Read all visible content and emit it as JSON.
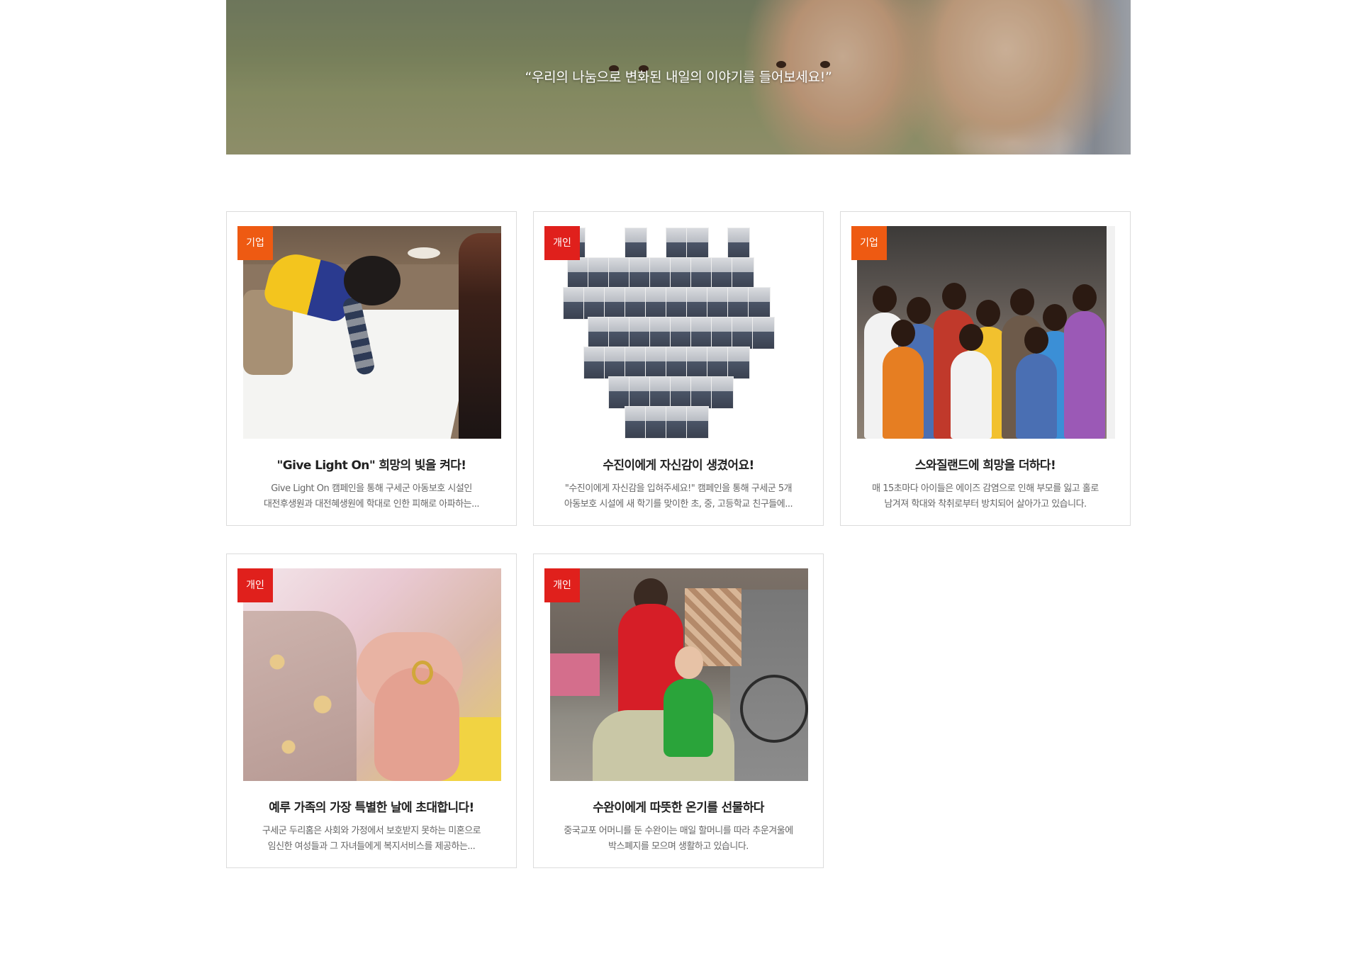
{
  "hero": {
    "quote": "“우리의 나눔으로 변화된 내일의 이야기를 들어보세요!”"
  },
  "colors": {
    "badge_corporate": "#ee5a12",
    "badge_individual": "#e0201c",
    "card_border": "#dcdcdc",
    "title_text": "#222222",
    "description_text": "#666666"
  },
  "cards": [
    {
      "badge": "기업",
      "badge_type": "corporate",
      "image": "child-drawing-on-paper-photo",
      "title": "\"Give Light On\" 희망의 빛을 켜다!",
      "desc_line1": "Give Light On 캠페인을 통해 구세군 아동보호 시설인",
      "desc_line2": "대전후생원과 대전혜생원에 학대로 인한 피해로 아파하는..."
    },
    {
      "badge": "개인",
      "badge_type": "individual",
      "image": "heart-photo-collage",
      "title": "수진이에게 자신감이 생겼어요!",
      "desc_line1": "\"수진이에게 자신감을 입혀주세요!\" 캠페인을 통해 구세군 5개",
      "desc_line2": "아동보호 시설에 새 학기를 맞이한 초, 중, 고등학교 친구들에..."
    },
    {
      "badge": "기업",
      "badge_type": "corporate",
      "image": "waving-children-photo",
      "title": "스와질랜드에 희망을 더하다!",
      "desc_line1": "매 15초마다 아이들은 에이즈 감염으로 인해 부모를 잃고 홀로",
      "desc_line2": "남겨져 학대와 착취로부터 방치되어 살아가고 있습니다."
    },
    {
      "badge": "개인",
      "badge_type": "individual",
      "image": "baby-hand-ring-photo",
      "title": "예루 가족의 가장 특별한 날에 초대합니다!",
      "desc_line1": "구세군 두리홈은 사회와 가정에서 보호받지 못하는 미혼으로",
      "desc_line2": "임신한 여성들과 그 자녀들에게 복지서비스를 제공하는..."
    },
    {
      "badge": "개인",
      "badge_type": "individual",
      "image": "grandmother-and-child-photo",
      "title": "수완이에게 따뜻한 온기를 선물하다",
      "desc_line1": "중국교포 어머니를 둔 수완이는 매일 할머니를 따라 추운겨울에",
      "desc_line2": "박스폐지를 모으며 생활하고 있습니다."
    }
  ]
}
